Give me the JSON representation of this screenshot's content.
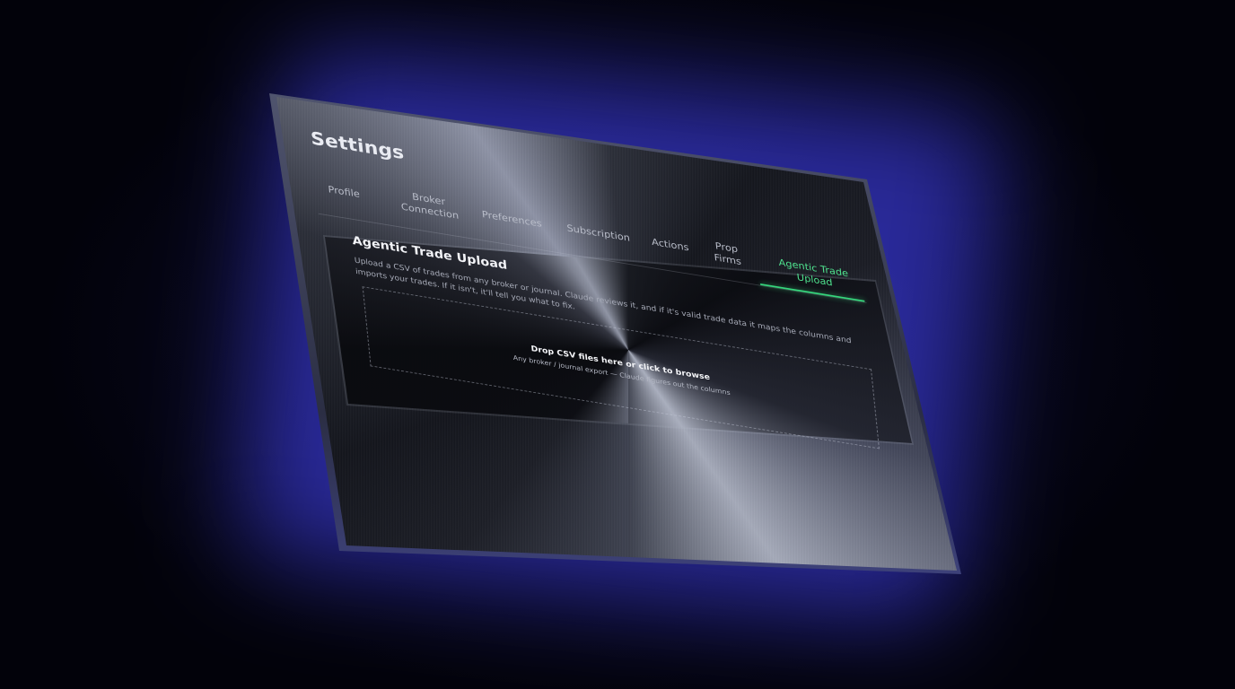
{
  "page": {
    "title": "Settings"
  },
  "tabs": [
    {
      "label": "Profile",
      "active": false
    },
    {
      "label": "Broker\nConnection",
      "active": false
    },
    {
      "label": "Preferences",
      "active": false
    },
    {
      "label": "Subscription",
      "active": false
    },
    {
      "label": "Actions",
      "active": false
    },
    {
      "label": "Prop\nFirms",
      "active": false
    },
    {
      "label": "Agentic Trade Upload",
      "active": true
    }
  ],
  "upload": {
    "title": "Agentic Trade Upload",
    "description": "Upload a CSV of trades from any broker or journal. Claude reviews it, and if it's valid trade data it maps the columns and imports your trades. If it isn't, it'll tell you what to fix.",
    "dropzone": {
      "primary": "Drop CSV files here or click to browse",
      "secondary": "Any broker / journal export — Claude figures out the columns"
    }
  },
  "colors": {
    "accent": "#35d67c",
    "background": "#02020a",
    "glow": "#4646ff"
  }
}
